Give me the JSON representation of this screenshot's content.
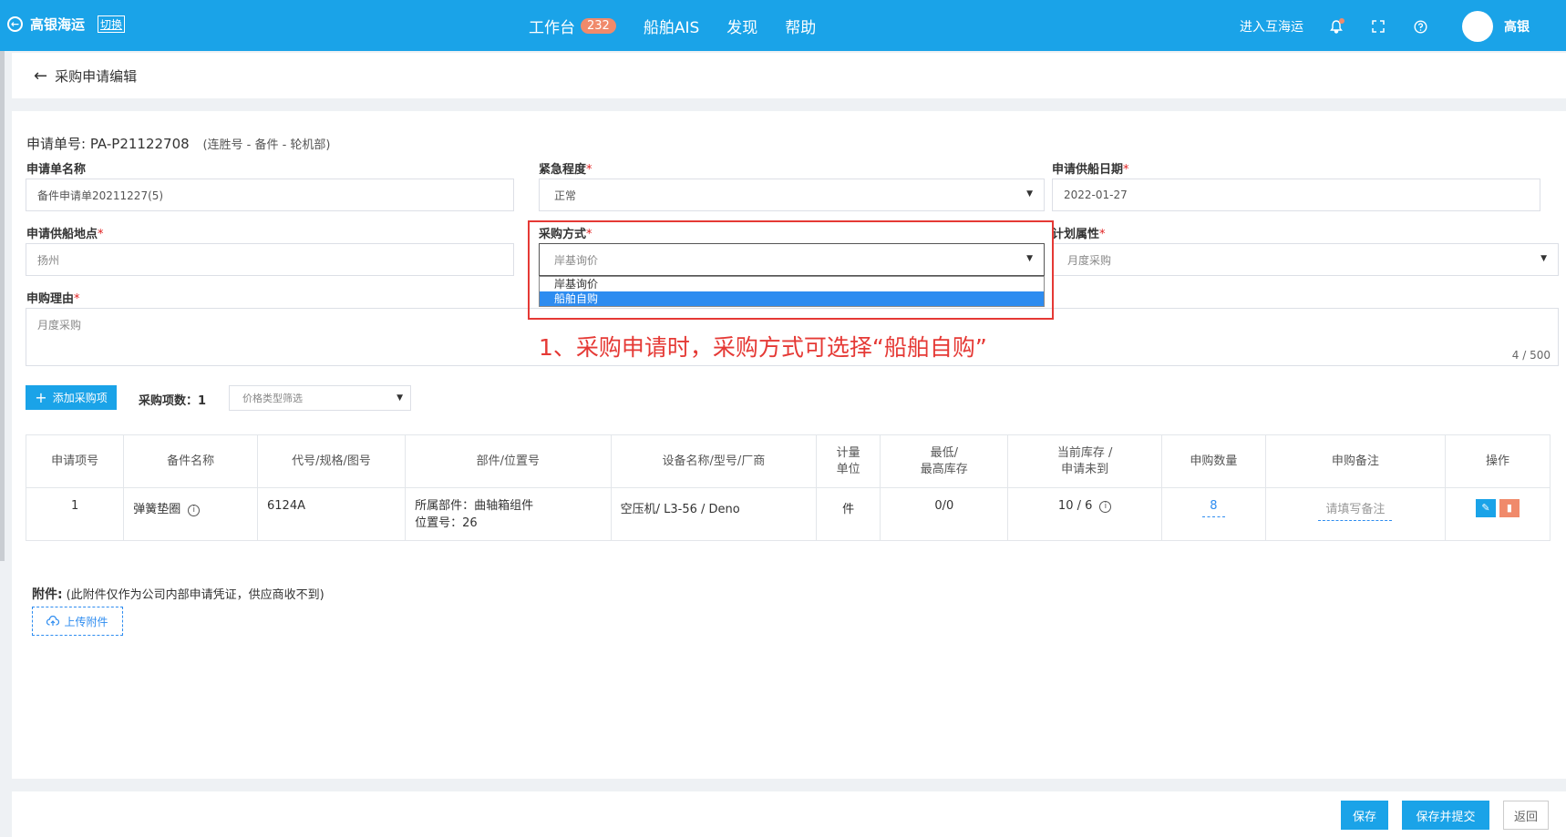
{
  "header": {
    "brand": "高银海运",
    "switch_label": "切换",
    "nav": [
      {
        "label": "工作台",
        "badge": "232"
      },
      {
        "label": "船舶AIS"
      },
      {
        "label": "发现"
      },
      {
        "label": "帮助"
      }
    ],
    "enter_label": "进入互海运",
    "user_name": "高银"
  },
  "breadcrumb": {
    "title": "采购申请编辑"
  },
  "request": {
    "number_label": "申请单号:",
    "number": "PA-P21122708",
    "ship_info": "(连胜号 - 备件 - 轮机部)"
  },
  "form": {
    "name": {
      "label": "申请单名称",
      "value": "备件申请单20211227(5)"
    },
    "urgency": {
      "label": "紧急程度",
      "value": "正常"
    },
    "supply_date": {
      "label": "申请供船日期",
      "value": "2022-01-27"
    },
    "supply_place": {
      "label": "申请供船地点",
      "value": "扬州"
    },
    "purchase_method": {
      "label": "采购方式",
      "value": "岸基询价",
      "options": [
        "岸基询价",
        "船舶自购"
      ],
      "highlighted_option": "船舶自购"
    },
    "plan_attr": {
      "label": "计划属性",
      "value": "月度采购"
    },
    "reason": {
      "label": "申购理由",
      "value": "月度采购",
      "counter": "4 / 500"
    },
    "required_mark": "*"
  },
  "annotation": "1、采购申请时，采购方式可选择“船舶自购”",
  "toolbar": {
    "add_label": "添加采购项",
    "count_label": "采购项数：",
    "count": "1",
    "filter_placeholder": "价格类型筛选"
  },
  "table": {
    "headers": [
      "申请项号",
      "备件名称",
      "代号/规格/图号",
      "部件/位置号",
      "设备名称/型号/厂商",
      "计量\n单位",
      "最低/\n最高库存",
      "当前库存 /\n申请未到",
      "申购数量",
      "申购备注",
      "操作"
    ],
    "rows": [
      {
        "no": "1",
        "name": "弹簧垫圈",
        "code": "6124A",
        "component": "所属部件：曲轴箱组件",
        "position": "位置号：26",
        "equipment": "空压机/ L3-56 / Deno",
        "unit": "件",
        "stock_range": "0/0",
        "stock_current": "10 / 6",
        "qty": "8",
        "remark_placeholder": "请填写备注"
      }
    ]
  },
  "attachment": {
    "title": "附件:",
    "note": "(此附件仅作为公司内部申请凭证，供应商收不到)",
    "upload_label": "上传附件"
  },
  "footer": {
    "save": "保存",
    "save_submit": "保存并提交",
    "back": "返回"
  }
}
